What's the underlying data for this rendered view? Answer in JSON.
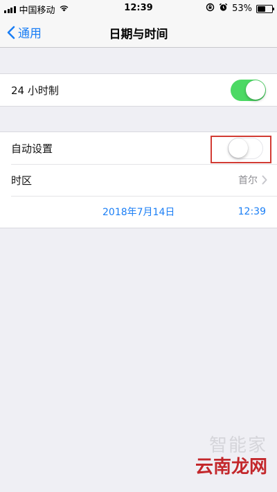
{
  "status_bar": {
    "carrier": "中国移动",
    "time": "12:39",
    "battery_percent": "53%",
    "battery_level": 0.53
  },
  "nav": {
    "back_label": "通用",
    "title": "日期与时间"
  },
  "settings": {
    "hour24": {
      "label": "24 小时制",
      "enabled": true
    },
    "auto_set": {
      "label": "自动设置",
      "enabled": false
    },
    "timezone": {
      "label": "时区",
      "value": "首尔"
    },
    "date": "2018年7月14日",
    "time": "12:39"
  },
  "watermark": {
    "line1": "智能家",
    "line2": "云南龙网"
  },
  "colors": {
    "accent": "#1a7ef5",
    "switch_on": "#4cd964",
    "highlight": "#d23b33"
  }
}
